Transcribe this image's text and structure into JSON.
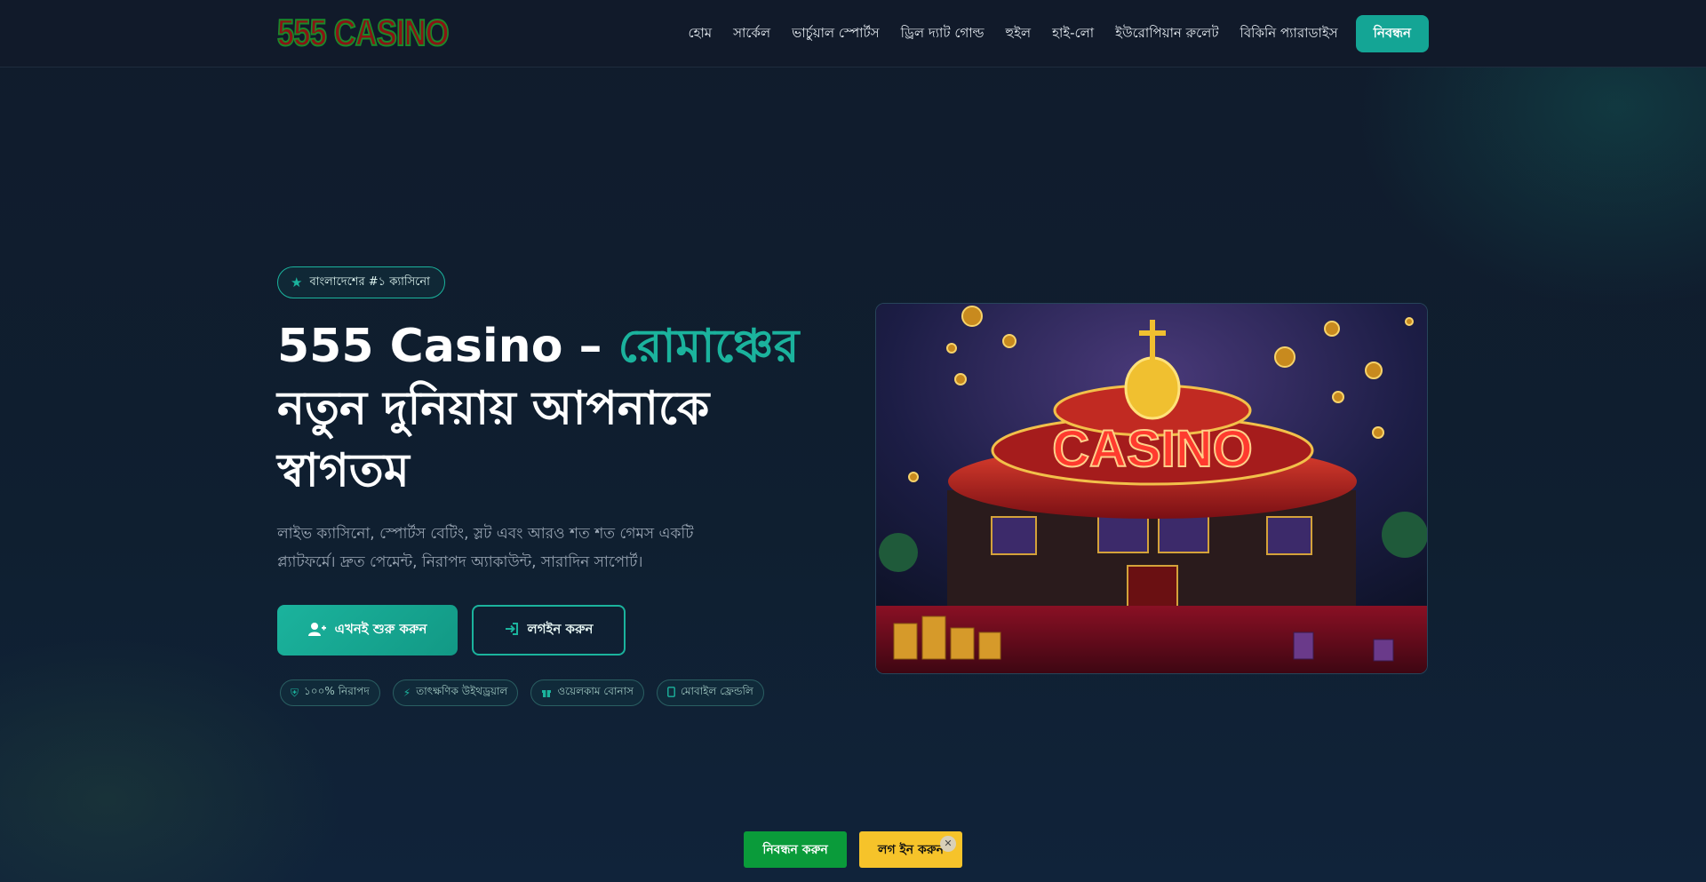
{
  "header": {
    "logo_text": "555 CASINO",
    "nav": [
      {
        "label": "হোম"
      },
      {
        "label": "সার্কেল"
      },
      {
        "label": "ভার্চুয়াল স্পোর্টস"
      },
      {
        "label": "ড্রিল দ্যাট গোল্ড"
      },
      {
        "label": "হুইল"
      },
      {
        "label": "হাই-লো"
      },
      {
        "label": "ইউরোপিয়ান রুলেট"
      },
      {
        "label": "বিকিনি প্যারাডাইস"
      }
    ],
    "cta_label": "নিবন্ধন"
  },
  "hero": {
    "badge_icon": "star-icon",
    "badge_text": "বাংলাদেশের #১ ক্যাসিনো",
    "title_main": "555 Casino – ",
    "title_accent": "রোমাঞ্চের",
    "title_rest": "নতুন দুনিয়ায় আপনাকে স্বাগতম",
    "subtitle": "লাইভ ক্যাসিনো, স্পোর্টস বেটিং, স্লট এবং আরও শত শত গেমস একটি প্ল্যাটফর্মে। দ্রুত পেমেন্ট, নিরাপদ অ্যাকাউন্ট, সারাদিন সাপোর্ট।",
    "primary_button": "এখনই শুরু করুন",
    "secondary_button": "লগইন করুন",
    "features": [
      {
        "icon": "shield-icon",
        "label": "১০০% নিরাপদ"
      },
      {
        "icon": "bolt-icon",
        "label": "তাৎক্ষণিক উইথড্রয়াল"
      },
      {
        "icon": "gift-icon",
        "label": "ওয়েলকাম বোনাস"
      },
      {
        "icon": "mobile-icon",
        "label": "মোবাইল ফ্রেন্ডলি"
      }
    ],
    "image_text": "CASINO"
  },
  "floating_bar": {
    "register_label": "নিবন্ধন করুন",
    "login_label": "লগ ইন করুন",
    "close_icon": "close-icon"
  },
  "colors": {
    "accent": "#1bb39d",
    "register_green": "#0a9b3a",
    "login_yellow": "#f6c32a",
    "background": "#0f1c2b"
  }
}
